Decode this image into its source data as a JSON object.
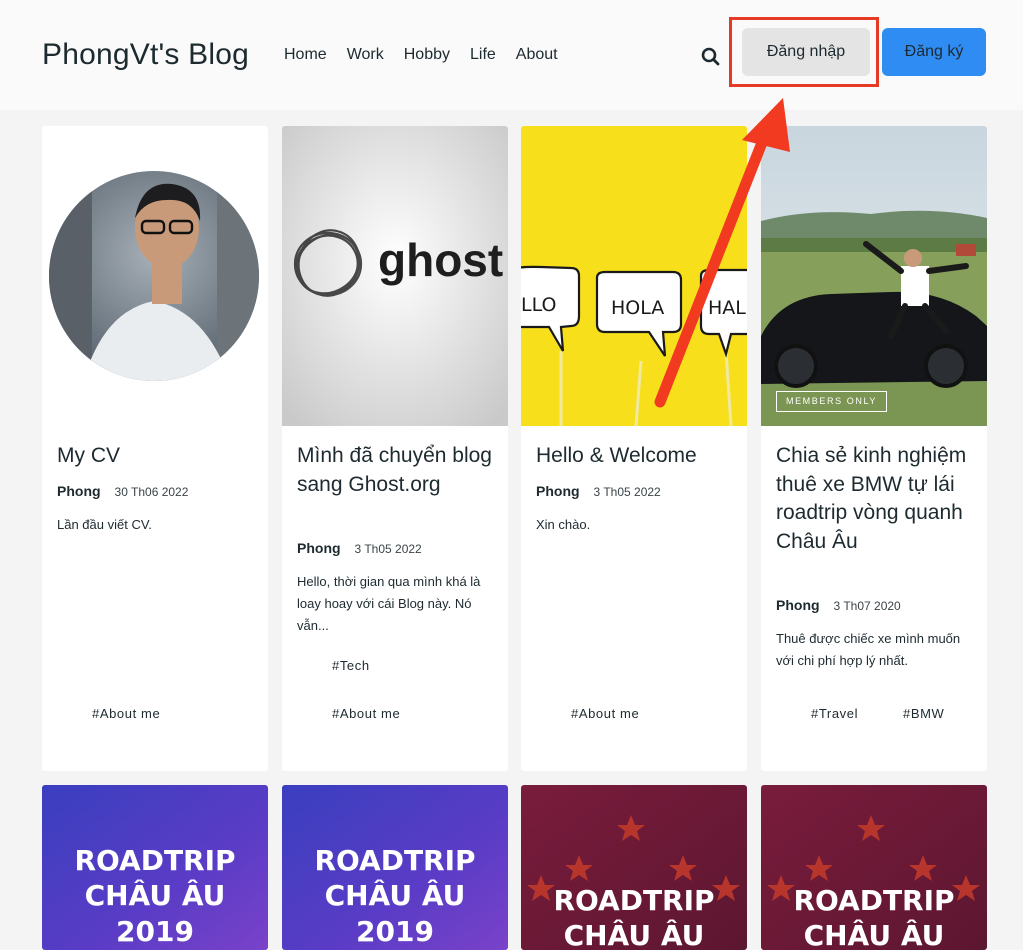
{
  "header": {
    "brand": "PhongVt's Blog",
    "nav": [
      "Home",
      "Work",
      "Hobby",
      "Life",
      "About"
    ],
    "login_label": "Đăng nhập",
    "signup_label": "Đăng ký"
  },
  "colors": {
    "accent": "#2f8cf3",
    "highlight": "#e53b24"
  },
  "cards": [
    {
      "title": "My CV",
      "author": "Phong",
      "date": "30 Th06 2022",
      "excerpt": "Lần đầu viết CV.",
      "tags": [
        "#About me"
      ]
    },
    {
      "title": "Mình đã chuyển blog sang Ghost.org",
      "author": "Phong",
      "date": "3 Th05 2022",
      "excerpt": "Hello, thời gian qua mình khá là loay hoay với cái Blog này. Nó vẫn...",
      "tags": [
        "#Tech",
        "#About me"
      ],
      "image_logo_text": "ghost"
    },
    {
      "title": "Hello & Welcome",
      "author": "Phong",
      "date": "3 Th05 2022",
      "excerpt": "Xin chào.",
      "tags": [
        "#About me"
      ],
      "bubbles": [
        "LLO",
        "HOLA",
        "HALL"
      ]
    },
    {
      "title": "Chia sẻ kinh nghiệm thuê xe BMW tự lái roadtrip vòng quanh Châu Âu",
      "author": "Phong",
      "date": "3 Th07 2020",
      "excerpt": "Thuê được chiếc xe mình muốn với chi phí hợp lý nhất.",
      "tags": [
        "#Travel",
        "#BMW"
      ],
      "badge": "MEMBERS ONLY"
    }
  ],
  "posters": [
    {
      "line1": "ROADTRIP",
      "line2": "CHÂU ÂU",
      "line3": "2019"
    },
    {
      "line1": "ROADTRIP",
      "line2": "CHÂU ÂU",
      "line3": "2019"
    },
    {
      "line1": "ROADTRIP",
      "line2": "CHÂU ÂU"
    },
    {
      "line1": "ROADTRIP",
      "line2": "CHÂU ÂU"
    }
  ]
}
